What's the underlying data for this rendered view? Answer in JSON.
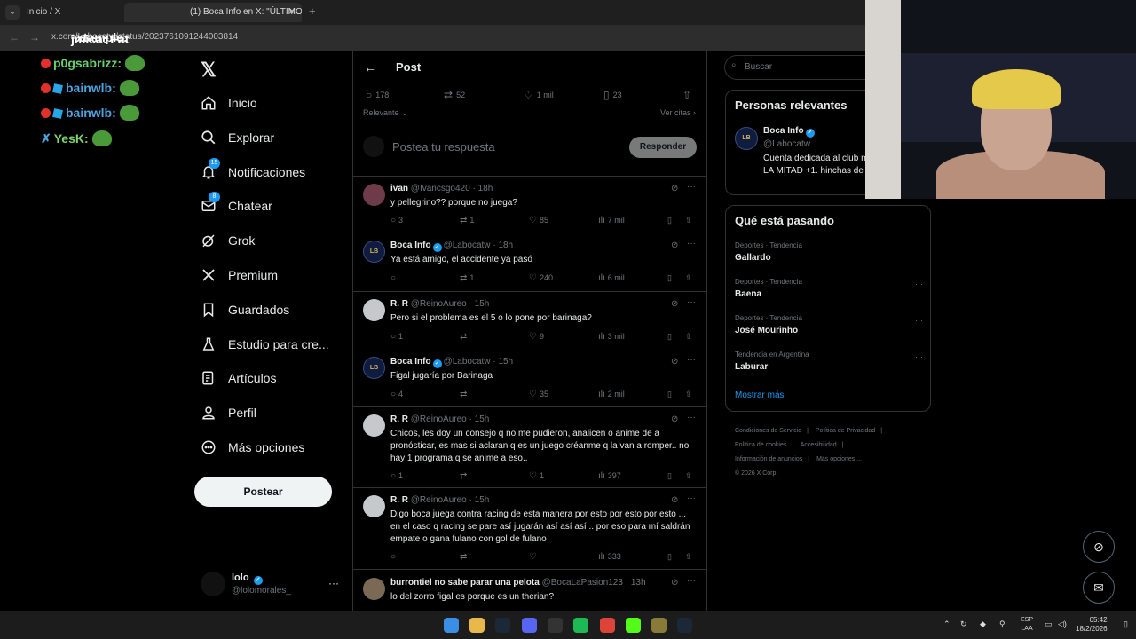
{
  "browser": {
    "tab1_label": "Inicio / X",
    "tab2_label": "(1) Boca Info en X: \"ÚLTIMO M",
    "url": "x.com/Labocatw/status/2023761091244003814"
  },
  "chat": [
    {
      "user": "jmica",
      "message": "Fat"
    },
    {
      "user": "p0gsabrizz",
      "message": ""
    },
    {
      "user": "bainwlb",
      "message": ""
    },
    {
      "user": "bainwlb",
      "message": ""
    },
    {
      "user": "YesK",
      "message": ""
    }
  ],
  "chat_top": "xtample",
  "nav": {
    "items": [
      {
        "label": "Inicio",
        "icon": "home-icon"
      },
      {
        "label": "Explorar",
        "icon": "search-icon"
      },
      {
        "label": "Notificaciones",
        "icon": "bell-icon",
        "badge": "15"
      },
      {
        "label": "Chatear",
        "icon": "mail-icon",
        "badge": "8"
      },
      {
        "label": "Grok",
        "icon": "grok-icon"
      },
      {
        "label": "Premium",
        "icon": "x-icon"
      },
      {
        "label": "Guardados",
        "icon": "bookmark-icon"
      },
      {
        "label": "Estudio para cre...",
        "icon": "flask-icon"
      },
      {
        "label": "Artículos",
        "icon": "article-icon"
      },
      {
        "label": "Perfil",
        "icon": "person-icon"
      },
      {
        "label": "Más opciones",
        "icon": "more-circle-icon"
      }
    ],
    "post_button": "Postear",
    "profile_name": "lolo",
    "profile_handle": "@lolomorales_"
  },
  "post": {
    "title": "Post",
    "stats": {
      "replies": "178",
      "reposts": "52",
      "likes": "1 mil",
      "bookmarks": "23"
    },
    "sort_label": "Relevante",
    "quotes_label": "Ver citas",
    "reply_placeholder": "Postea tu respuesta",
    "reply_button": "Responder"
  },
  "replies": [
    {
      "name": "ivan",
      "handle": "@Ivancsgo420",
      "time": "18h",
      "verified": false,
      "text": "y pellegrino?? porque no juega?",
      "replies": "3",
      "reposts": "1",
      "likes": "85",
      "views": "7 mil"
    },
    {
      "name": "Boca Info",
      "handle": "@Labocatw",
      "time": "18h",
      "verified": true,
      "text": "Ya está amigo, el accidente ya pasó",
      "replies": "",
      "reposts": "1",
      "likes": "240",
      "views": "6 mil"
    },
    {
      "name": "R. R",
      "handle": "@ReinoAureo",
      "time": "15h",
      "verified": false,
      "text": "Pero si el problema es el 5 o lo pone por barinaga?",
      "replies": "1",
      "reposts": "",
      "likes": "9",
      "views": "3 mil"
    },
    {
      "name": "Boca Info",
      "handle": "@Labocatw",
      "time": "15h",
      "verified": true,
      "text": "Figal jugaría por Barinaga",
      "replies": "4",
      "reposts": "",
      "likes": "35",
      "views": "2 mil"
    },
    {
      "name": "R. R",
      "handle": "@ReinoAureo",
      "time": "15h",
      "verified": false,
      "text": "Chicos, les doy un consejo q no me pudieron, analicen o anime de a pronósticar, es mas si aclaran q es un juego créanme q la van a romper.. no hay 1 programa q se anime a eso..",
      "replies": "1",
      "reposts": "",
      "likes": "1",
      "views": "397"
    },
    {
      "name": "R. R",
      "handle": "@ReinoAureo",
      "time": "15h",
      "verified": false,
      "text": "Digo boca juega contra racing de esta manera por esto por esto por esto ... en el caso q racing se pare así jugarán así así así .. por eso para mí saldrán empate o gana fulano con gol de fulano",
      "replies": "",
      "reposts": "",
      "likes": "",
      "views": "333"
    },
    {
      "name": "burrontiel no sabe parar una pelota",
      "handle": "@BocaLaPasion123",
      "time": "13h",
      "verified": false,
      "text": "lo del zorro figal es porque es un therian?",
      "replies": "",
      "reposts": "",
      "likes": "",
      "views": ""
    }
  ],
  "right": {
    "search_placeholder": "Buscar",
    "relevant_title": "Personas relevantes",
    "relevant_name": "Boca Info",
    "relevant_handle": "@Labocatw",
    "relevant_bio": "Cuenta dedicada al club m del mundo. LA MITAD +1. hinchas de Boca.",
    "trends_title": "Qué está pasando",
    "trends": [
      {
        "category": "Deportes · Tendencia",
        "name": "Gallardo"
      },
      {
        "category": "Deportes · Tendencia",
        "name": "Baena"
      },
      {
        "category": "Deportes · Tendencia",
        "name": "José Mourinho"
      },
      {
        "category": "Tendencia en Argentina",
        "name": "Laburar"
      }
    ],
    "show_more": "Mostrar más",
    "footer": [
      "Condiciones de Servicio",
      "Política de Privacidad",
      "Política de cookies",
      "Accesibilidad",
      "Información de anuncios",
      "Más opciones ...",
      "© 2026 X Corp."
    ]
  },
  "taskbar": {
    "lang_1": "ESP",
    "lang_2": "LAA",
    "time": "05:42",
    "date": "18/2/2026"
  },
  "colors": {
    "accent": "#1d9bf0",
    "background": "#000000",
    "border": "#2f3336",
    "muted": "#71767b"
  }
}
